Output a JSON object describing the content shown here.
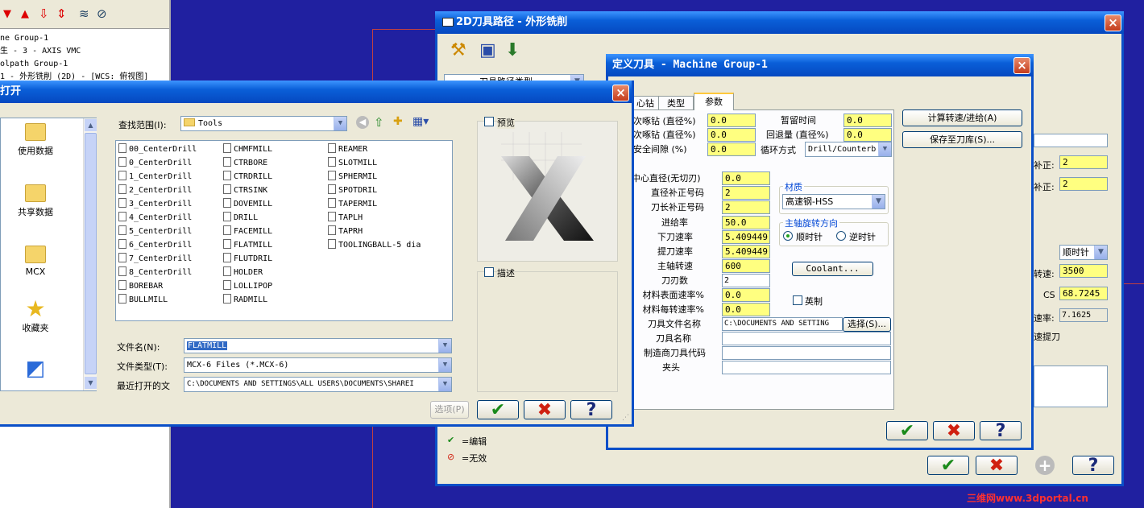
{
  "left_panel": {
    "tree": [
      "ne Group-1",
      "生 - 3 - AXIS VMC",
      "olpath Group-1",
      "1 - 外形铣削 (2D) - [WCS: 俯视图]"
    ]
  },
  "toolpath_dialog": {
    "title": "2D刀具路径 - 外形铣削",
    "section": "刀具路径类型",
    "right_fields": {
      "comp1_label": "补正:",
      "comp1": "2",
      "comp2_label": "补正:",
      "comp2": "2",
      "dir": "顺时针",
      "speed_label": "转速:",
      "speed": "3500",
      "cs_label": "CS",
      "cs": "68.7245",
      "rate_label": "速率:",
      "rate": "7.1625",
      "rapid_label": "速提刀"
    },
    "legend": [
      {
        "mark": "✔",
        "text": "=编辑"
      },
      {
        "mark": "⊘",
        "text": "=无效"
      }
    ]
  },
  "define_tool_dialog": {
    "title": "定义刀具 - Machine Group-1",
    "tabs": [
      "心钻",
      "类型",
      "参数"
    ],
    "active_tab": "参数",
    "peck1_label": "次啄钻 (直径%)",
    "peck1": "0.0",
    "peck2_label": "次啄钻 (直径%)",
    "peck2": "0.0",
    "clearance_label": "安全间隙 (%)",
    "clearance": "0.0",
    "dwell_label": "暂留时间",
    "dwell": "0.0",
    "retract_label": "回退量 (直径%)",
    "retract": "0.0",
    "cycle_label": "循环方式",
    "cycle": "Drill/Counterb",
    "center_dia_label": "中心直径(无切刃)",
    "center_dia": "0.0",
    "dia_offset_label": "直径补正号码",
    "dia_offset": "2",
    "len_offset_label": "刀长补正号码",
    "len_offset": "2",
    "feed_label": "进给率",
    "feed": "50.0",
    "plunge_label": "下刀速率",
    "plunge": "5.409449",
    "retract_rate_label": "提刀速率",
    "retract_rate": "5.409449",
    "spindle_label": "主轴转速",
    "spindle": "600",
    "flutes_label": "刀刃数",
    "flutes": "2",
    "sfm_label": "材料表面速率%",
    "sfm": "0.0",
    "fpt_label": "材料每转速率%",
    "fpt": "0.0",
    "tool_file_label": "刀具文件名称",
    "tool_file": "C:\\DOCUMENTS AND SETTING",
    "tool_name_label": "刀具名称",
    "tool_name": "",
    "mfr_label": "制造商刀具代码",
    "mfr": "",
    "holder_label": "夹头",
    "holder": "",
    "material_group": "材质",
    "material": "高速钢-HSS",
    "rotation_group": "主轴旋转方向",
    "cw": "顺时针",
    "ccw": "逆时针",
    "coolant": "Coolant...",
    "metric": "英制",
    "select": "选择(S)...",
    "calc_btn": "计算转速/进给(A)",
    "save_btn": "保存至刀库(S)..."
  },
  "open_dialog": {
    "title": "打开",
    "lookin_label": "查找范围(I):",
    "lookin": "Tools",
    "places": [
      "使用数据",
      "共享数据",
      "MCX",
      "收藏夹"
    ],
    "files_col1": [
      "00_CenterDrill",
      "0_CenterDrill",
      "1_CenterDrill",
      "2_CenterDrill",
      "3_CenterDrill",
      "4_CenterDrill",
      "5_CenterDrill",
      "6_CenterDrill",
      "7_CenterDrill",
      "8_CenterDrill",
      "BOREBAR",
      "BULLMILL"
    ],
    "files_col2": [
      "CHMFMILL",
      "CTRBORE",
      "CTRDRILL",
      "CTRSINK",
      "DOVEMILL",
      "DRILL",
      "FACEMILL",
      "FLATMILL",
      "FLUTDRIL",
      "HOLDER",
      "LOLLIPOP",
      "RADMILL"
    ],
    "files_col3": [
      "REAMER",
      "SLOTMILL",
      "SPHERMIL",
      "SPOTDRIL",
      "TAPERMIL",
      "TAPLH",
      "TAPRH",
      "TOOLINGBALL-5 dia"
    ],
    "preview_label": "预览",
    "desc_label": "描述",
    "filename_label": "文件名(N):",
    "filename": "FLATMILL",
    "filetype_label": "文件类型(T):",
    "filetype": "MCX-6 Files (*.MCX-6)",
    "recent_label": "最近打开的文",
    "recent": "C:\\DOCUMENTS AND SETTINGS\\ALL USERS\\DOCUMENTS\\SHAREI",
    "preview_btn": "选项(P)"
  },
  "buttons": {
    "ok": "✔",
    "cancel": "✖",
    "help": "?"
  },
  "watermark": "三维网www.3dportal.cn",
  "colors": {
    "background": "#2020a0",
    "field_yellow": "#ffff80",
    "title_blue": "#0a5fd8"
  }
}
